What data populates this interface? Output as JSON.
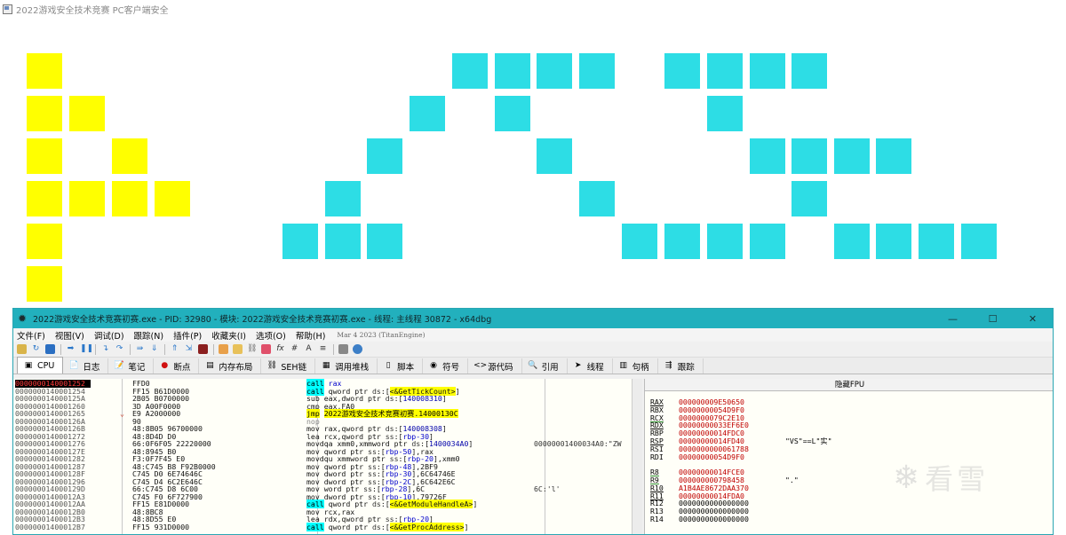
{
  "game": {
    "title": "2022游戏安全技术竞赛 PC客户端安全",
    "colors": {
      "yellow": "#ffff00",
      "cyan": "#2ddde5"
    }
  },
  "debugger": {
    "title": "2022游戏安全技术竞赛初赛.exe - PID: 32980 - 模块: 2022游戏安全技术竞赛初赛.exe - 线程: 主线程 30872 - x64dbg",
    "window_buttons": {
      "minimize": "—",
      "maximize": "☐",
      "close": "✕"
    },
    "menu": [
      "文件(F)",
      "视图(V)",
      "调试(D)",
      "跟踪(N)",
      "插件(P)",
      "收藏夹(I)",
      "选项(O)",
      "帮助(H)"
    ],
    "build_info": "Mar 4 2023 (TitanEngine)",
    "tabs": [
      {
        "label": "CPU",
        "icon": "cpu-icon",
        "glyph": "▣"
      },
      {
        "label": "日志",
        "icon": "log-icon",
        "glyph": "📄"
      },
      {
        "label": "笔记",
        "icon": "notes-icon",
        "glyph": "📝"
      },
      {
        "label": "断点",
        "icon": "breakpoint-icon",
        "glyph": "●"
      },
      {
        "label": "内存布局",
        "icon": "memory-map-icon",
        "glyph": "▤"
      },
      {
        "label": "SEH链",
        "icon": "seh-icon",
        "glyph": "⛓"
      },
      {
        "label": "调用堆栈",
        "icon": "call-stack-icon",
        "glyph": "▦"
      },
      {
        "label": "脚本",
        "icon": "script-icon",
        "glyph": "▯"
      },
      {
        "label": "符号",
        "icon": "symbols-icon",
        "glyph": "◉"
      },
      {
        "label": "源代码",
        "icon": "source-icon",
        "glyph": "<>"
      },
      {
        "label": "引用",
        "icon": "references-icon",
        "glyph": "🔍"
      },
      {
        "label": "线程",
        "icon": "threads-icon",
        "glyph": "➤"
      },
      {
        "label": "句柄",
        "icon": "handles-icon",
        "glyph": "▥"
      },
      {
        "label": "跟踪",
        "icon": "trace-icon",
        "glyph": "⇶"
      }
    ],
    "disasm": [
      {
        "addr": "0000000140001252",
        "mark": "",
        "bytes": "FFD0",
        "sel": true,
        "parts": [
          [
            "call",
            "call"
          ],
          [
            "",
            " "
          ],
          [
            "reg",
            "rax"
          ]
        ]
      },
      {
        "addr": "0000000140001254",
        "mark": "",
        "bytes": "FF15 B61D0000",
        "parts": [
          [
            "call",
            "call"
          ],
          [
            "",
            " qword ptr "
          ],
          [
            "seg",
            "ds"
          ],
          [
            "",
            ":["
          ],
          [
            "sym",
            "<&GetTickCount>"
          ],
          [
            "",
            "]"
          ]
        ]
      },
      {
        "addr": "000000014000125A",
        "mark": "",
        "bytes": "2B05 B0700000",
        "parts": [
          [
            "",
            "sub eax,dword ptr "
          ],
          [
            "seg",
            "ds"
          ],
          [
            "",
            ":["
          ],
          [
            "imm",
            "140008310"
          ],
          [
            "",
            "]"
          ]
        ]
      },
      {
        "addr": "0000000140001260",
        "mark": "",
        "bytes": "3D A00F0000",
        "parts": [
          [
            "",
            "cmp eax,FA0"
          ]
        ]
      },
      {
        "addr": "0000000140001265",
        "mark": "⌄",
        "bytes": "E9 A2000000",
        "parts": [
          [
            "jmp",
            "jmp"
          ],
          [
            "",
            " "
          ],
          [
            "jmp",
            "2022游戏安全技术竞赛初赛.14000130C"
          ]
        ]
      },
      {
        "addr": "000000014000126A",
        "mark": "",
        "bytes": "90",
        "parts": [
          [
            "grey",
            "nop"
          ]
        ]
      },
      {
        "addr": "000000014000126B",
        "mark": "",
        "bytes": "48:8B05 96700000",
        "parts": [
          [
            "",
            "mov rax,qword ptr "
          ],
          [
            "seg",
            "ds"
          ],
          [
            "",
            ":["
          ],
          [
            "imm",
            "140008308"
          ],
          [
            "",
            "]"
          ]
        ]
      },
      {
        "addr": "0000000140001272",
        "mark": "",
        "bytes": "48:8D4D D0",
        "parts": [
          [
            "",
            "lea rcx,qword ptr "
          ],
          [
            "seg",
            "ss"
          ],
          [
            "",
            ":["
          ],
          [
            "reg",
            "rbp-30"
          ],
          [
            "",
            "]"
          ]
        ]
      },
      {
        "addr": "0000000140001276",
        "mark": "",
        "bytes": "66:0F6F05 22220000",
        "parts": [
          [
            "",
            "movdqa xmm0,xmmword ptr "
          ],
          [
            "seg",
            "ds"
          ],
          [
            "",
            ":["
          ],
          [
            "imm",
            "1400034A0"
          ],
          [
            "",
            "]"
          ]
        ],
        "comment": "00000001400034A0:\"ZW"
      },
      {
        "addr": "000000014000127E",
        "mark": "",
        "bytes": "48:8945 B0",
        "parts": [
          [
            "",
            "mov qword ptr "
          ],
          [
            "seg",
            "ss"
          ],
          [
            "",
            ":["
          ],
          [
            "reg",
            "rbp-50"
          ],
          [
            "",
            "],rax"
          ]
        ]
      },
      {
        "addr": "0000000140001282",
        "mark": "",
        "bytes": "F3:0F7F45 E0",
        "parts": [
          [
            "",
            "movdqu xmmword ptr "
          ],
          [
            "seg",
            "ss"
          ],
          [
            "",
            ":["
          ],
          [
            "reg",
            "rbp-20"
          ],
          [
            "",
            "],xmm0"
          ]
        ]
      },
      {
        "addr": "0000000140001287",
        "mark": "",
        "bytes": "48:C745 B8 F92B0000",
        "parts": [
          [
            "",
            "mov qword ptr "
          ],
          [
            "seg",
            "ss"
          ],
          [
            "",
            ":["
          ],
          [
            "reg",
            "rbp-48"
          ],
          [
            "",
            "],2BF9"
          ]
        ]
      },
      {
        "addr": "000000014000128F",
        "mark": "",
        "bytes": "C745 D0 6E74646C",
        "parts": [
          [
            "",
            "mov dword ptr "
          ],
          [
            "seg",
            "ss"
          ],
          [
            "",
            ":["
          ],
          [
            "reg",
            "rbp-30"
          ],
          [
            "",
            "],6C64746E"
          ]
        ]
      },
      {
        "addr": "0000000140001296",
        "mark": "",
        "bytes": "C745 D4 6C2E646C",
        "parts": [
          [
            "",
            "mov dword ptr "
          ],
          [
            "seg",
            "ss"
          ],
          [
            "",
            ":["
          ],
          [
            "reg",
            "rbp-2C"
          ],
          [
            "",
            "],6C642E6C"
          ]
        ]
      },
      {
        "addr": "000000014000129D",
        "mark": "",
        "bytes": "66:C745 D8 6C00",
        "parts": [
          [
            "",
            "mov word ptr "
          ],
          [
            "seg",
            "ss"
          ],
          [
            "",
            ":["
          ],
          [
            "reg",
            "rbp-28"
          ],
          [
            "",
            "],6C"
          ]
        ],
        "comment": "6C:'l'"
      },
      {
        "addr": "00000001400012A3",
        "mark": "",
        "bytes": "C745 F0 6F727900",
        "parts": [
          [
            "",
            "mov dword ptr "
          ],
          [
            "seg",
            "ss"
          ],
          [
            "",
            ":["
          ],
          [
            "reg",
            "rbp-10"
          ],
          [
            "",
            "],79726F"
          ]
        ]
      },
      {
        "addr": "00000001400012AA",
        "mark": "",
        "bytes": "FF15 E81D0000",
        "parts": [
          [
            "call",
            "call"
          ],
          [
            "",
            " qword ptr "
          ],
          [
            "seg",
            "ds"
          ],
          [
            "",
            ":["
          ],
          [
            "sym",
            "<&GetModuleHandleA>"
          ],
          [
            "",
            "]"
          ]
        ]
      },
      {
        "addr": "00000001400012B0",
        "mark": "",
        "bytes": "48:8BC8",
        "parts": [
          [
            "",
            "mov rcx,rax"
          ]
        ]
      },
      {
        "addr": "00000001400012B3",
        "mark": "",
        "bytes": "48:8D55 E0",
        "parts": [
          [
            "",
            "lea rdx,qword ptr "
          ],
          [
            "seg",
            "ss"
          ],
          [
            "",
            ":["
          ],
          [
            "reg",
            "rbp-20"
          ],
          [
            "",
            "]"
          ]
        ]
      },
      {
        "addr": "00000001400012B7",
        "mark": "",
        "bytes": "FF15 931D0000",
        "parts": [
          [
            "call",
            "call"
          ],
          [
            "",
            " qword ptr "
          ],
          [
            "seg",
            "ds"
          ],
          [
            "",
            ":["
          ],
          [
            "sym",
            "<&GetProcAddress>"
          ],
          [
            "",
            "]"
          ]
        ]
      }
    ],
    "fpu_button": "隐藏FPU",
    "registers": [
      {
        "name": "RAX",
        "value": "000000009E50650",
        "style": "mod",
        "color": "red"
      },
      {
        "name": "RBX",
        "value": "00000000054D9F0",
        "style": "",
        "color": "red"
      },
      {
        "name": "RCX",
        "value": "0000000079C2E10",
        "style": "mod2",
        "color": "red"
      },
      {
        "name": "RDX",
        "value": "00000000033EF6E0",
        "style": "mod",
        "color": "red"
      },
      {
        "name": "RBP",
        "value": "00000000014FDC0",
        "style": "",
        "color": "red"
      },
      {
        "name": "RSP",
        "value": "00000000014FD40",
        "style": "mod",
        "color": "red",
        "comment": "\"VS\"==L\"实\""
      },
      {
        "name": "RSI",
        "value": "0000000000061788",
        "style": "",
        "color": "red"
      },
      {
        "name": "RDI",
        "value": "00000000054D9F0",
        "style": "",
        "color": "red"
      },
      {
        "name": "",
        "value": "",
        "style": "",
        "color": ""
      },
      {
        "name": "R8",
        "value": "00000000014FCE0",
        "style": "mod2",
        "color": "red"
      },
      {
        "name": "R9",
        "value": "000000000798458",
        "style": "mod2",
        "color": "red",
        "comment": "\".\""
      },
      {
        "name": "R10",
        "value": "A1B4AE8672DAA370",
        "style": "mod",
        "color": "red"
      },
      {
        "name": "R11",
        "value": "00000000014FDA0",
        "style": "mod",
        "color": "red"
      },
      {
        "name": "R12",
        "value": "0000000000000000",
        "style": "",
        "color": "black"
      },
      {
        "name": "R13",
        "value": "0000000000000000",
        "style": "",
        "color": "black"
      },
      {
        "name": "R14",
        "value": "0000000000000000",
        "style": "",
        "color": "black"
      }
    ],
    "watermark": "看雪"
  }
}
